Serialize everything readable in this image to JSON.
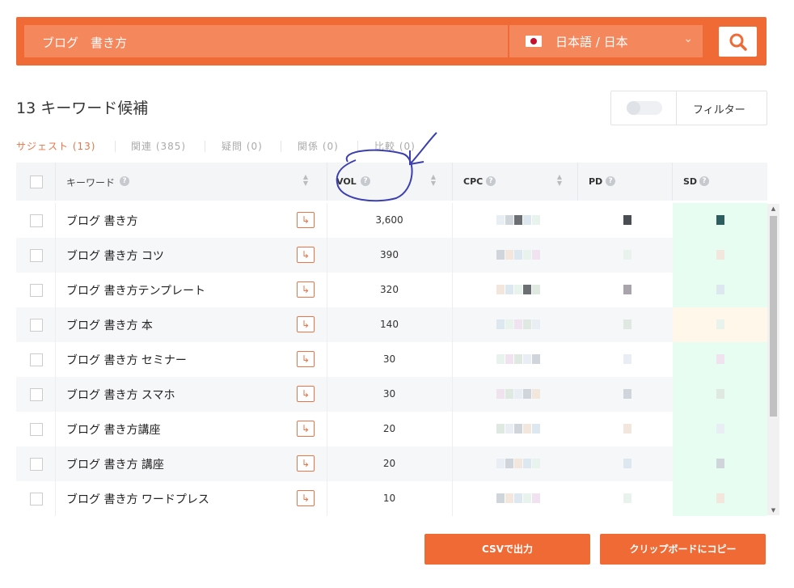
{
  "search": {
    "query": "ブログ　書き方",
    "language_label": "日本語 / 日本",
    "chevron": "⌄"
  },
  "results": {
    "title": "13 キーワード候補"
  },
  "filter": {
    "label": "フィルター"
  },
  "tabs": [
    {
      "label": "サジェスト (13)",
      "active": true
    },
    {
      "label": "関連 (385)",
      "active": false
    },
    {
      "label": "疑問 (0)",
      "active": false
    },
    {
      "label": "関係 (0)",
      "active": false
    },
    {
      "label": "比較 (0)",
      "active": false
    }
  ],
  "table": {
    "columns": {
      "keyword": "キーワード",
      "vol": "VOL",
      "cpc": "CPC",
      "pd": "PD",
      "sd": "SD"
    },
    "help_glyph": "?",
    "go_glyph": "↳",
    "rows": [
      {
        "keyword": "ブログ 書き方",
        "vol": "3,600"
      },
      {
        "keyword": "ブログ 書き方 コツ",
        "vol": "390"
      },
      {
        "keyword": "ブログ 書き方テンプレート",
        "vol": "320"
      },
      {
        "keyword": "ブログ 書き方 本",
        "vol": "140"
      },
      {
        "keyword": "ブログ 書き方 セミナー",
        "vol": "30"
      },
      {
        "keyword": "ブログ 書き方 スマホ",
        "vol": "30"
      },
      {
        "keyword": "ブログ 書き方講座",
        "vol": "20"
      },
      {
        "keyword": "ブログ 書き方 講座",
        "vol": "20"
      },
      {
        "keyword": "ブログ 書き方 ワードプレス",
        "vol": "10"
      }
    ]
  },
  "actions": {
    "csv": "CSVで出力",
    "clipboard": "クリップボードにコピー"
  },
  "scrollbar": {
    "up": "▲",
    "down": "▼"
  },
  "colors": {
    "brand": "#f06a35",
    "brand_light": "#f4875c",
    "tab_active": "#e8754a",
    "sd_easy": "#e8fdf1",
    "sd_medium": "#fff8ea",
    "annotation": "#3b3fb0"
  }
}
